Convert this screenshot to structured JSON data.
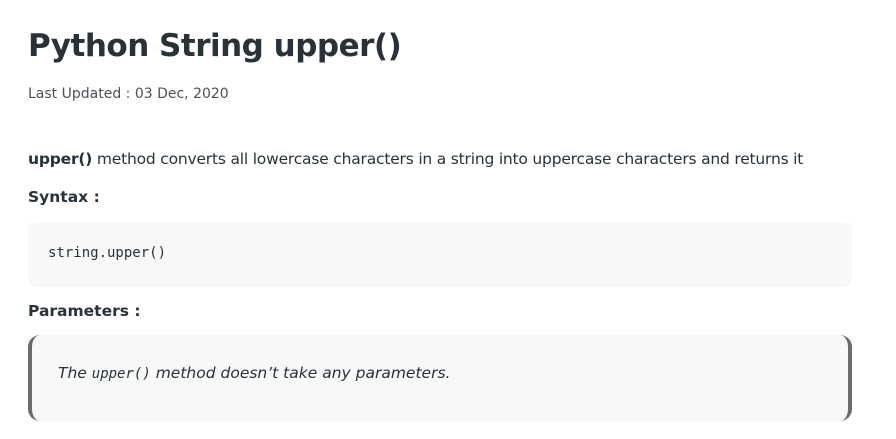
{
  "article": {
    "title": "Python String upper()",
    "last_updated": "Last Updated : 03 Dec, 2020",
    "intro": {
      "method_name": "upper()",
      "description": " method converts all lowercase characters in a string into uppercase characters and returns it"
    },
    "syntax": {
      "heading": "Syntax :",
      "code": "string.upper()"
    },
    "parameters": {
      "heading": "Parameters :",
      "note_prefix": "The ",
      "note_code": "upper()",
      "note_suffix": " method doesn’t take any parameters."
    }
  }
}
